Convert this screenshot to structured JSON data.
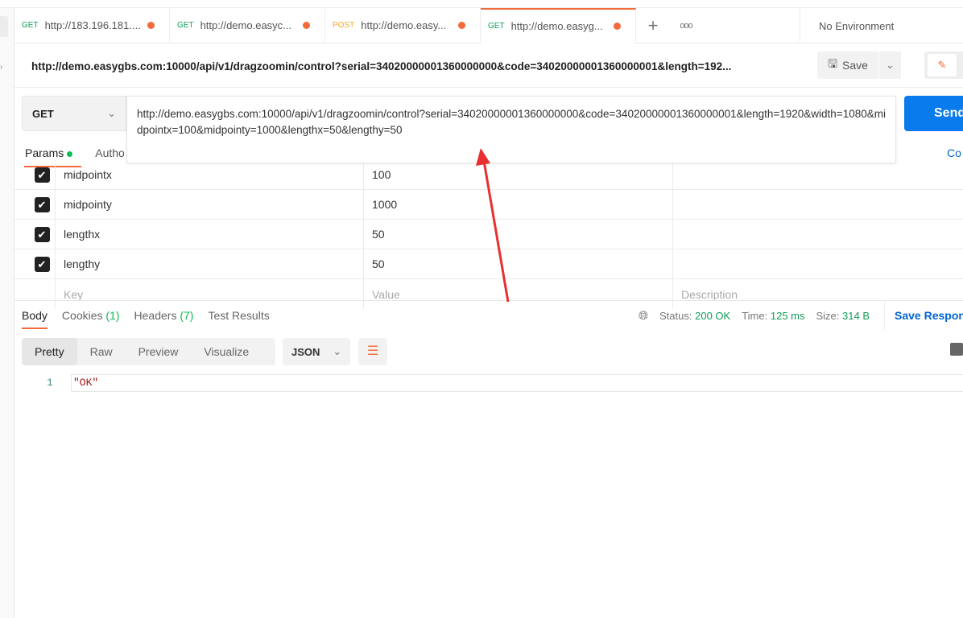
{
  "tabs": [
    {
      "method": "GET",
      "url": "http://183.196.181...."
    },
    {
      "method": "GET",
      "url": "http://demo.easyc..."
    },
    {
      "method": "POST",
      "url": "http://demo.easy..."
    },
    {
      "method": "GET",
      "url": "http://demo.easyg..."
    }
  ],
  "tab_new": "+",
  "tab_more": "ooo",
  "environment": "No Environment",
  "request_title": "http://demo.easygbs.com:10000/api/v1/dragzoomin/control?serial=34020000001360000000&code=34020000001360000001&length=192...",
  "save_label": "Save",
  "method": "GET",
  "url": "http://demo.easygbs.com:10000/api/v1/dragzoomin/control?serial=34020000001360000000&code=34020000001360000001&length=1920&width=1080&midpointx=100&midpointy=1000&lengthx=50&lengthy=50",
  "send_label": "Send",
  "code_label": "Co",
  "request_tabs": {
    "params": "Params",
    "auth": "Autho"
  },
  "params": [
    {
      "key": "midpointx",
      "value": "100"
    },
    {
      "key": "midpointy",
      "value": "1000"
    },
    {
      "key": "lengthx",
      "value": "50"
    },
    {
      "key": "lengthy",
      "value": "50"
    }
  ],
  "param_placeholders": {
    "key": "Key",
    "value": "Value",
    "description": "Description"
  },
  "response_tabs": {
    "body": "Body",
    "cookies": "Cookies",
    "cookies_count": "(1)",
    "headers": "Headers",
    "headers_count": "(7)",
    "tests": "Test Results"
  },
  "status": {
    "status_label": "Status:",
    "status": "200 OK",
    "time_label": "Time:",
    "time": "125 ms",
    "size_label": "Size:",
    "size": "314 B"
  },
  "save_response": "Save Respons",
  "view_modes": [
    "Pretty",
    "Raw",
    "Preview",
    "Visualize"
  ],
  "format": "JSON",
  "response_body": {
    "line": "1",
    "content": "\"OK\""
  },
  "colors": {
    "accent": "#f26b3a",
    "send": "#097bed",
    "success": "#0f9d58",
    "annotation": "#e83030"
  }
}
